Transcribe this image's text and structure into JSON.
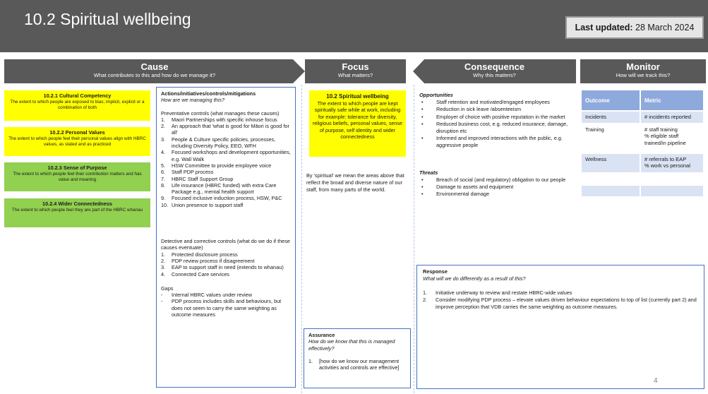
{
  "header": {
    "title": "10.2 Spiritual wellbeing",
    "updated_label": "Last updated:",
    "updated_date": "28 March 2024"
  },
  "banners": {
    "cause": {
      "title": "Cause",
      "subtitle": "What contributes to this and how do we manage it?"
    },
    "focus": {
      "title": "Focus",
      "subtitle": "What matters?"
    },
    "consequence": {
      "title": "Consequence",
      "subtitle": "Why this matters?"
    },
    "monitor": {
      "title": "Monitor",
      "subtitle": "How will we track this?"
    }
  },
  "causes": [
    {
      "title": "10.2.1 Cultural Competency",
      "desc": "The extent to which people are exposed to bias; implicit, explicit or a combination of both",
      "color": "#ffff00"
    },
    {
      "title": "10.2.2 Personal Values",
      "desc": "The extent to which people feel their personal values align with HBRC values, as stated and as practiced",
      "color": "#ffff00"
    },
    {
      "title": "10.2.3 Sense of Purpose",
      "desc": "The extent to which people feel their contribution matters and has value and meaning",
      "color": "#92d050"
    },
    {
      "title": "10.2.4 Wider Connectedness",
      "desc": "The extent to which people feel they are part of the HBRC whanau",
      "color": "#92d050"
    }
  ],
  "actions": {
    "heading": "Actions/initiatives/controls/mitigations",
    "subheading": "How are we managing this?",
    "preventative_heading": "Preventative controls (what manages these causes)",
    "preventative": [
      {
        "n": "1.",
        "t": "Maori Partnerships with specific inhouse focus"
      },
      {
        "n": "2.",
        "t": "An approach that 'what is good for Māori is good for all'"
      },
      {
        "n": "3.",
        "t": "People & Culture specific policies, processes, including Diversity Policy, EEO, WFH"
      },
      {
        "n": "4.",
        "t": "Focused workshops and development opportunities, e.g. Wall Walk"
      },
      {
        "n": "5.",
        "t": "HSW Committee to provide employee voice"
      },
      {
        "n": "6.",
        "t": "Staff PDP process"
      },
      {
        "n": "7.",
        "t": "HBRC Staff Support Group"
      },
      {
        "n": "8.",
        "t": "Life insurance (HBRC funded) with extra Care Package e.g., mental health support"
      },
      {
        "n": "9.",
        "t": "Focused inclusive induction process, HSW, P&C"
      },
      {
        "n": "10.",
        "t": "Union presence to support staff"
      }
    ],
    "detective_heading": "Detective and corrective controls (what do we do if these causes eventuate)",
    "detective": [
      {
        "n": "1.",
        "t": "Protected disclosure process"
      },
      {
        "n": "2.",
        "t": "PDP review process if disagreement"
      },
      {
        "n": "3.",
        "t": "EAP to support staff in need (extends to whanau)"
      },
      {
        "n": "4.",
        "t": "Connected Care services"
      }
    ],
    "gaps_heading": "Gaps",
    "gaps": [
      {
        "n": "-",
        "t": "Internal HBRC values under review"
      },
      {
        "n": "-",
        "t": "PDP process includes skills and behaviours, but does not seem to carry the same weighting as outcome measures"
      }
    ]
  },
  "focus": {
    "title": "10.2 Spiritual wellbeing",
    "desc": "The extent to which people are kept spiritually safe while at work, including for example: tolerance for diversity, religious beliefs, personal values, sense of purpose, self identity and wider connectedness",
    "note": "By 'spiritual' we mean the areas above that reflect the broad and diverse nature of our staff, from many parts of the world."
  },
  "assurance": {
    "heading": "Assurance",
    "subheading": "How do we know that this is managed effectively?",
    "items": [
      {
        "n": "1.",
        "t": "[how do we know our management activities and controls are effective]"
      }
    ]
  },
  "consequence": {
    "opportunities_heading": "Opportunities",
    "opportunities": [
      "Staff retention and motivated/engaged employees",
      "Reduction in sick leave /absenteeism",
      "Employer of choice with positive reputation in the market",
      "Reduced business cost, e.g. reduced insurance, damage, disruption etc",
      "Informed and improved interactions with the public, e.g. aggressive people"
    ],
    "threats_heading": "Threats",
    "threats": [
      "Breach of social (and regulatory) obligation to our people",
      "Damage to assets and equipment",
      "Environmental damage"
    ]
  },
  "response": {
    "heading": "Response",
    "subheading": "What will we do differently as a result of this?",
    "items": [
      {
        "n": "1.",
        "t": "Initiative underway to review and restate HBRC-wide values"
      },
      {
        "n": "2.",
        "t": "Consider modifying PDP process – elevate values driven behaviour expectations to top of list (currently part 2) and improve perception that VDB carries the same weighting as outcome measures."
      }
    ]
  },
  "monitor": {
    "col_outcome": "Outcome",
    "col_metric": "Metric",
    "rows": [
      {
        "outcome": "Incidents",
        "metric": "# incidents reported"
      },
      {
        "outcome": "Training",
        "metric": "# staff training\n% eligible staff trained/in pipeline"
      },
      {
        "outcome": "Wellness",
        "metric": "# referrals to EAP\n% work vs personal"
      },
      {
        "outcome": "",
        "metric": ""
      },
      {
        "outcome": "",
        "metric": ""
      },
      {
        "outcome": "",
        "metric": ""
      }
    ]
  },
  "page_number": "4"
}
